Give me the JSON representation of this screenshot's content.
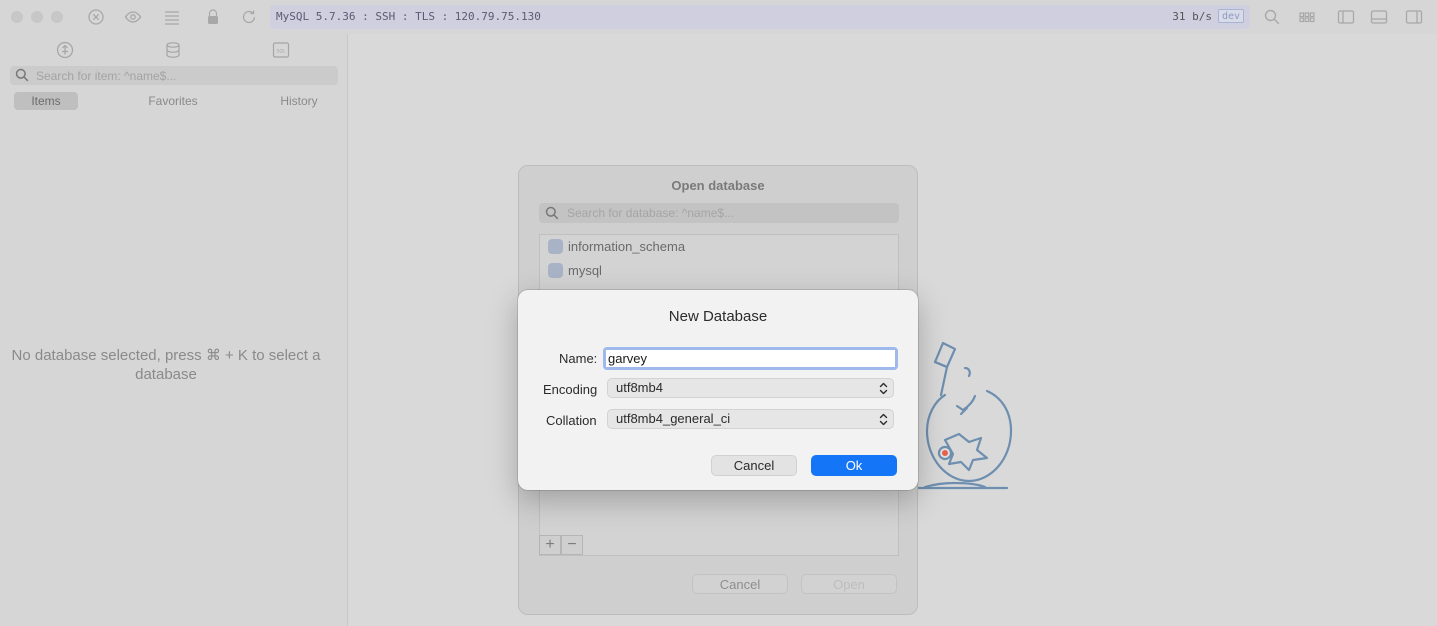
{
  "toolbar": {
    "connection": "MySQL 5.7.36 : SSH : TLS : 120.79.75.130",
    "rate": "31 b/s",
    "badge": "dev"
  },
  "sidebar": {
    "search_placeholder": "Search for item: ^name$...",
    "segments": [
      "Items",
      "Favorites",
      "History"
    ],
    "active_segment": "Items",
    "empty_message": "No database selected, press ⌘ + K to select a database"
  },
  "open_database": {
    "title": "Open database",
    "search_placeholder": "Search for database: ^name$...",
    "databases": [
      "information_schema",
      "mysql"
    ],
    "add_label": "+",
    "remove_label": "−",
    "cancel_label": "Cancel",
    "open_label": "Open"
  },
  "new_database": {
    "title": "New Database",
    "name_label": "Name:",
    "name_value": "garvey",
    "encoding_label": "Encoding",
    "encoding_value": "utf8mb4",
    "collation_label": "Collation",
    "collation_value": "utf8mb4_general_ci",
    "cancel_label": "Cancel",
    "ok_label": "Ok"
  },
  "colors": {
    "accent": "#1476f7",
    "focus_ring": "#9fb9ec",
    "address_bar": "#cfcfe0"
  }
}
